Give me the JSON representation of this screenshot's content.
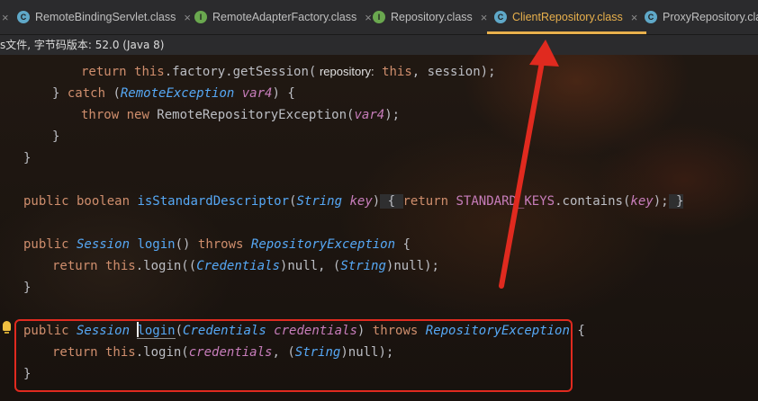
{
  "tabs": [
    {
      "label": "RemoteBindingServlet.class",
      "icon": "class-icon",
      "active": false
    },
    {
      "label": "RemoteAdapterFactory.class",
      "icon": "interface-icon",
      "active": false
    },
    {
      "label": "Repository.class",
      "icon": "interface-icon",
      "active": false
    },
    {
      "label": "ClientRepository.class",
      "icon": "class-icon",
      "active": true
    },
    {
      "label": "ProxyRepository.clas",
      "icon": "class-icon",
      "active": false
    }
  ],
  "info_bar": "s文件, 字节码版本: 52.0 (Java 8)",
  "code": {
    "l1": {
      "kw": "return",
      "this": "this",
      "field": ".factory",
      "method": ".getSession(",
      "hint": " repository:",
      "this2": "this",
      "rest": ", ",
      "hint2": "session",
      "end": ");"
    },
    "l2": {
      "brace": "} ",
      "kw": "catch",
      "open": " (",
      "type": "RemoteException",
      "param": " var4",
      "close": ") {"
    },
    "l3": {
      "kw": "throw",
      "kw2": " new",
      "type": " RemoteRepositoryException",
      "open": "(",
      "param": "var4",
      "close": ");"
    },
    "l4": "}",
    "l5": "}",
    "l6": {
      "kw": "public boolean",
      "name": " isStandardDescriptor",
      "open": "(",
      "type": "String",
      "param": " key",
      "close": ")",
      "fold_open": " { ",
      "kw2": "return",
      "field": " STANDARD_KEYS",
      "method": ".contains(",
      "param2": "key",
      "end": ");",
      "fold_close": " }"
    },
    "l7": {
      "kw": "public",
      "type": " Session",
      "name": " login",
      "sig": "() ",
      "kw2": "throws",
      "type2": " RepositoryException",
      "brace": " {"
    },
    "l8": {
      "kw": "return",
      "this": " this",
      "method": ".login(",
      "open": "(",
      "type": "Credentials",
      "mid": ")null, (",
      "type2": "String",
      "end": ")null);"
    },
    "l9": "}",
    "l10": {
      "kw": "public",
      "type": " Session ",
      "name": "login",
      "open": "(",
      "type2": "Credentials",
      "param": " credentials",
      "sig": ") ",
      "kw2": "throws",
      "type3": " RepositoryException",
      "brace": " {"
    },
    "l11": {
      "kw": "return",
      "this": " this",
      "method": ".login(",
      "param": "credentials",
      "mid": ", (",
      "type": "String",
      "end": ")null);"
    },
    "l12": "}"
  },
  "colors": {
    "accent": "#e8b04c",
    "annotation": "#e02a1f"
  }
}
